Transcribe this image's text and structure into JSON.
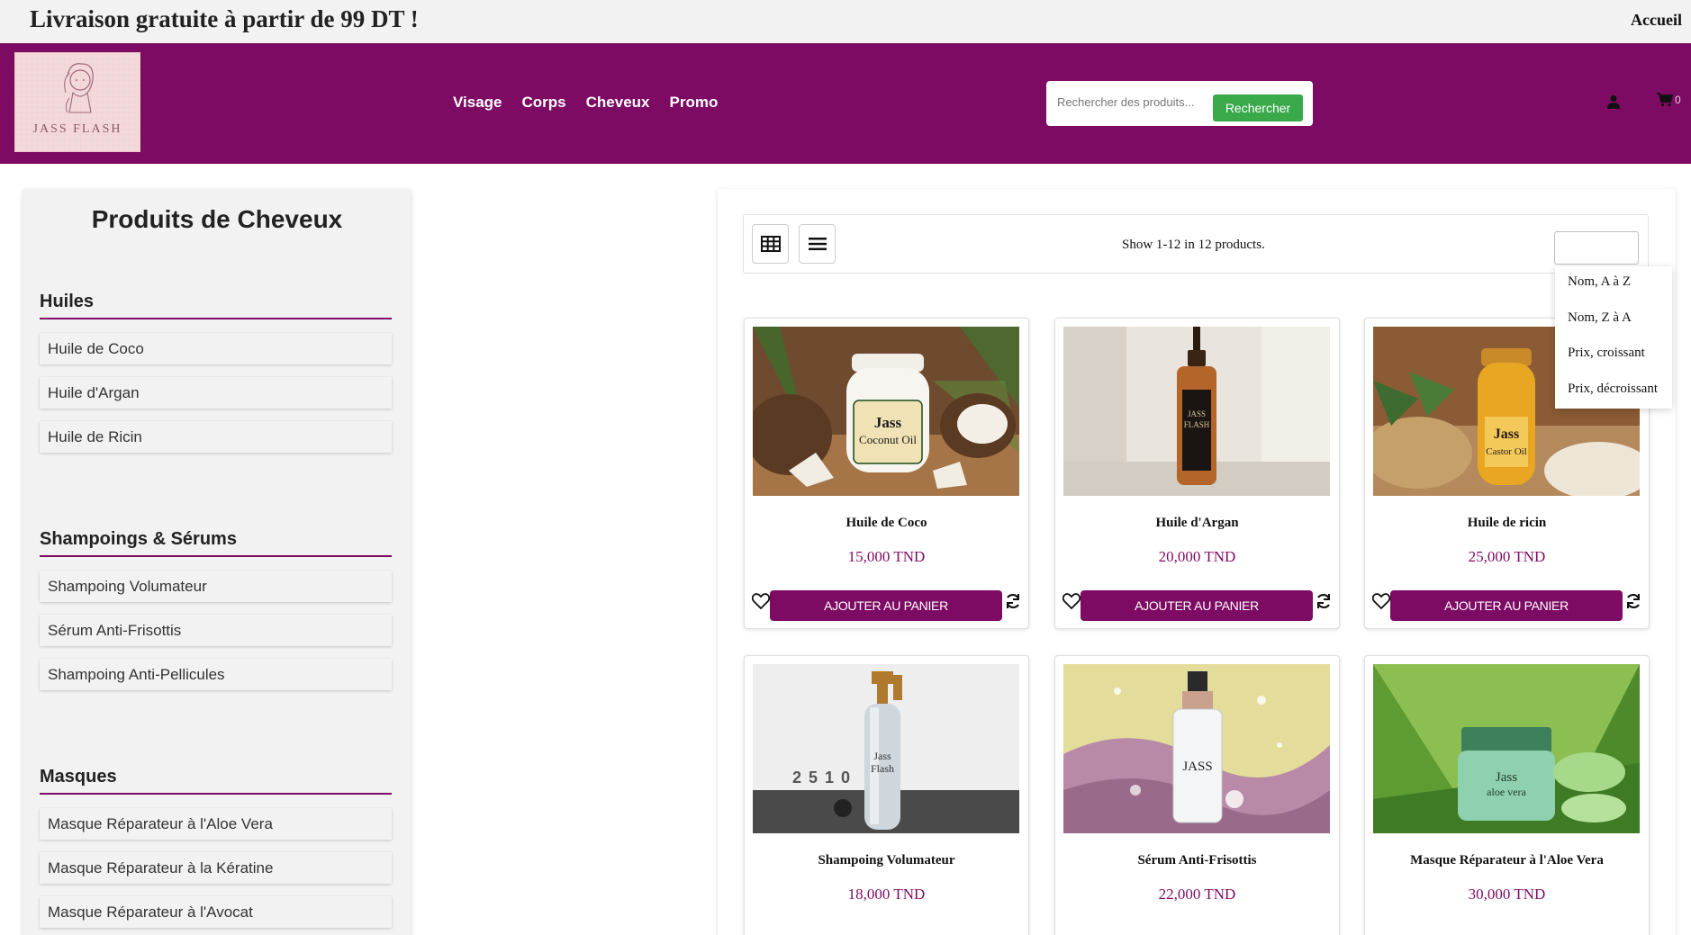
{
  "topbar": {
    "promo": "Livraison gratuite à partir de 99 DT !",
    "home_link": "Accueil"
  },
  "header": {
    "logo_text": "JASS FLASH",
    "nav": [
      "Visage",
      "Corps",
      "Cheveux",
      "Promo"
    ],
    "search": {
      "placeholder": "Rechercher des produits...",
      "button": "Rechercher"
    },
    "cart_count": "0",
    "brand_color": "#7d0a63",
    "search_button_color": "#3aa94a"
  },
  "sidebar": {
    "title": "Produits de Cheveux",
    "groups": [
      {
        "heading": "Huiles",
        "items": [
          "Huile de Coco",
          "Huile d'Argan",
          "Huile de Ricin"
        ]
      },
      {
        "heading": "Shampoings & Sérums",
        "items": [
          "Shampoing Volumateur",
          "Sérum Anti-Frisottis",
          "Shampoing Anti-Pellicules"
        ]
      },
      {
        "heading": "Masques",
        "items": [
          "Masque Réparateur à l'Aloe Vera",
          "Masque Réparateur à la Kératine",
          "Masque Réparateur à l'Avocat"
        ]
      }
    ]
  },
  "toolbar": {
    "show_text": "Show 1-12 in 12 products.",
    "grid_icon": "grid-icon",
    "list_icon": "list-icon"
  },
  "sort_options": [
    "Nom, A à Z",
    "Nom, Z à A",
    "Prix, croissant",
    "Prix, décroissant"
  ],
  "products": [
    {
      "name": "Huile de Coco",
      "price": "15,000 TND",
      "button": "AJOUTER AU PANIER",
      "label": "Jass Coconut Oil"
    },
    {
      "name": "Huile d'Argan",
      "price": "20,000 TND",
      "button": "AJOUTER AU PANIER",
      "label": "JASS FLASH"
    },
    {
      "name": "Huile de ricin",
      "price": "25,000 TND",
      "button": "AJOUTER AU PANIER",
      "label": "Jass Castor Oil"
    },
    {
      "name": "Shampoing Volumateur",
      "price": "18,000 TND",
      "button": "AJOUTER AU PANIER",
      "label": "Jass Flash"
    },
    {
      "name": "Sérum Anti-Frisottis",
      "price": "22,000 TND",
      "button": "AJOUTER AU PANIER",
      "label": "JASS"
    },
    {
      "name": "Masque Réparateur à l'Aloe Vera",
      "price": "30,000 TND",
      "button": "AJOUTER AU PANIER",
      "label": "Jass aloe vera"
    }
  ]
}
